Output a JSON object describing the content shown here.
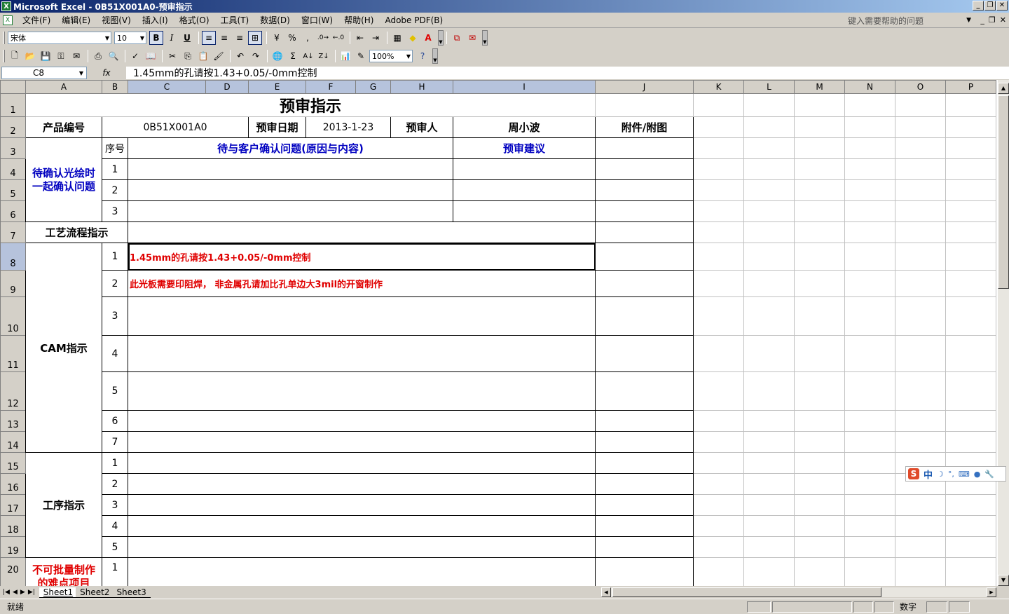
{
  "window": {
    "title": "Microsoft Excel - 0B51X001A0-预审指示"
  },
  "menu": [
    "文件(F)",
    "编辑(E)",
    "视图(V)",
    "插入(I)",
    "格式(O)",
    "工具(T)",
    "数据(D)",
    "窗口(W)",
    "帮助(H)",
    "Adobe PDF(B)"
  ],
  "help": {
    "placeholder": "键入需要帮助的问题"
  },
  "toolbar": {
    "font": "宋体",
    "size": "10",
    "bold": "B",
    "italic": "I",
    "underline": "U",
    "percent": "%",
    "comma": ",",
    "zoom": "100%",
    "sigma": "Σ"
  },
  "formula_bar": {
    "cell_ref": "C8",
    "fx": "fx",
    "content": "1.45mm的孔请按1.43+0.05/-0mm控制"
  },
  "columns": [
    "A",
    "B",
    "C",
    "D",
    "E",
    "F",
    "G",
    "H",
    "I",
    "J",
    "K",
    "L",
    "M",
    "N",
    "O",
    "P"
  ],
  "rows": [
    "1",
    "2",
    "3",
    "4",
    "5",
    "6",
    "7",
    "8",
    "9",
    "10",
    "11",
    "12",
    "13",
    "14",
    "15",
    "16",
    "17",
    "18",
    "19",
    "20"
  ],
  "sheet": {
    "title": "预审指示",
    "product_no_label": "产品编号",
    "product_no": "0B51X001A0",
    "review_date_label": "预审日期",
    "review_date": "2013-1-23",
    "reviewer_label": "预审人",
    "reviewer": "周小波",
    "attachment_label": "附件/附图",
    "seq_label": "序号",
    "issue_header": "待与客户确认问题(原因与内容)",
    "suggest_header": "预审建议",
    "pending_label": "待确认光绘时一起确认问题",
    "process_label": "工艺流程指示",
    "cam_label": "CAM指示",
    "cam_item1": "1.45mm的孔请按1.43+0.05/-0mm控制",
    "cam_item2": "此光板需要印阻焊， 非金属孔请加比孔单边大3mil的开窗制作",
    "step_label": "工序指示",
    "difficult_label": "不可批量制作的难点项目",
    "n1": "1",
    "n2": "2",
    "n3": "3",
    "n4": "4",
    "n5": "5",
    "n6": "6",
    "n7": "7"
  },
  "tabs": [
    "Sheet1",
    "Sheet2",
    "Sheet3"
  ],
  "status": {
    "ready": "就绪",
    "numlock": "数字"
  },
  "ime": {
    "zh": "中"
  }
}
